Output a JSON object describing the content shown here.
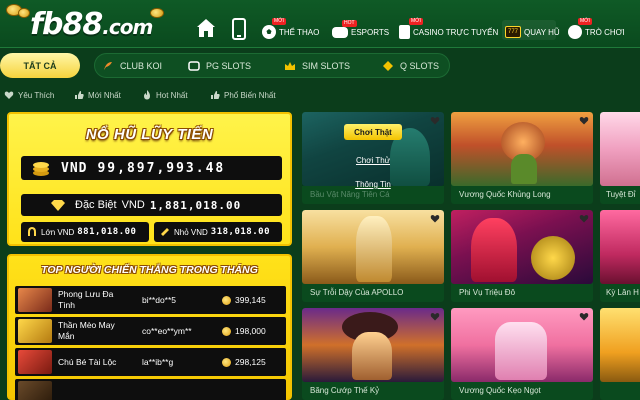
{
  "header": {
    "logo_main": "fb88",
    "logo_domain": ".com",
    "nav": [
      {
        "label": "THỂ THAO",
        "badge": "MỚI",
        "icon": "soccer-ball-icon"
      },
      {
        "label": "ESPORTS",
        "badge": "HOT",
        "icon": "gamepad-icon"
      },
      {
        "label": "CASINO TRỰC TUYẾN",
        "badge": "MỚI",
        "icon": "cards-icon"
      },
      {
        "label": "QUAY HŨ",
        "badge": "",
        "icon": "slot-777-icon"
      },
      {
        "label": "TRÒ CHƠI",
        "badge": "MỚI",
        "icon": "games-icon"
      }
    ],
    "slot_icon_text": "777"
  },
  "categories": {
    "tabs": [
      {
        "label": "TẤT CẢ",
        "icon": "all-icon",
        "active": true
      },
      {
        "label": "CLUB KOI",
        "icon": "koi-fish-icon",
        "active": false
      },
      {
        "label": "PG SLOTS",
        "icon": "pg-logo-icon",
        "active": false
      },
      {
        "label": "SIM SLOTS",
        "icon": "crown-icon",
        "active": false
      },
      {
        "label": "Q SLOTS",
        "icon": "q-slots-icon",
        "active": false
      }
    ]
  },
  "filters": [
    {
      "label": "Yêu Thích",
      "icon": "heart-icon"
    },
    {
      "label": "Mới Nhất",
      "icon": "thumbs-up-icon"
    },
    {
      "label": "Hot Nhất",
      "icon": "fire-icon"
    },
    {
      "label": "Phổ Biến Nhất",
      "icon": "like-icon"
    }
  ],
  "jackpot": {
    "title": "NỔ HŨ LŨY TIẾN",
    "main_currency": "VND",
    "main_amount": "99,897,993.48",
    "special_label": "Đặc Biệt",
    "special_currency": "VND",
    "special_amount": "1,881,018.00",
    "large_label": "Lớn VND",
    "large_amount": "881,018.00",
    "small_label": "Nhỏ VND",
    "small_amount": "318,018.00"
  },
  "top_winners": {
    "title": "TOP NGƯỜI CHIẾN THẮNG TRONG THÁNG",
    "rows": [
      {
        "game": "Phong Lưu Đa Tình",
        "user": "bi**do**5",
        "amount": "399,145",
        "color": "#b5542a"
      },
      {
        "game": "Thần Mèo May Mắn",
        "user": "co**eo**ym**",
        "amount": "198,000",
        "color": "#d4a020"
      },
      {
        "game": "Chú Bé Tài Lộc",
        "user": "la**ib**g",
        "amount": "298,125",
        "color": "#c23a2a"
      }
    ]
  },
  "games": [
    {
      "name": "Bầu Vật Năng Tiên Cá",
      "hover": true,
      "play_label": "Chơi Thật",
      "try_label": "Chơi Thử",
      "info_label": "Thông Tin",
      "art": "mermaid"
    },
    {
      "name": "Vương Quốc Khủng Long",
      "art": "dino"
    },
    {
      "name": "Tuyệt Đỉ",
      "art": "partial1"
    },
    {
      "name": "Sự Trỗi Dậy Của APOLLO",
      "art": "apollo"
    },
    {
      "name": "Phi Vụ Triệu Đô",
      "art": "heist"
    },
    {
      "name": "Kỳ Lân H",
      "art": "partial2"
    },
    {
      "name": "Băng Cướp Thế Kỷ",
      "art": "pirate"
    },
    {
      "name": "Vương Quốc Kẹo Ngọt",
      "art": "candy"
    },
    {
      "name": "",
      "art": "partial3"
    }
  ],
  "colors": {
    "background": "#0b3d1b",
    "accent_yellow": "#ffe21a",
    "panel_dark": "#0e0e0e"
  }
}
